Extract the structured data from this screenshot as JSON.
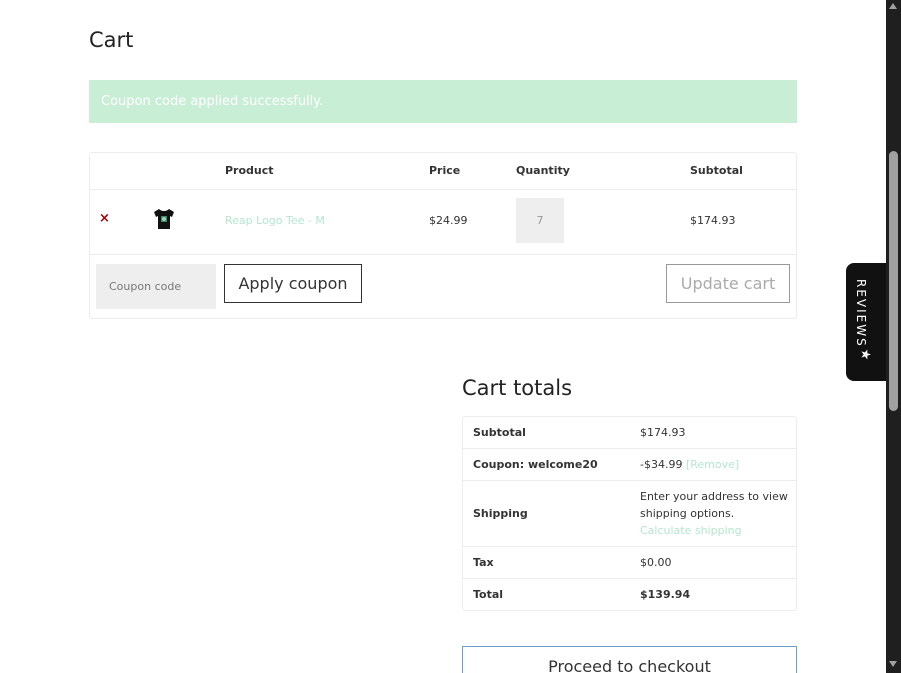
{
  "page": {
    "title": "Cart"
  },
  "notice": {
    "message": "Coupon code applied successfully."
  },
  "cart_table": {
    "headers": {
      "product": "Product",
      "price": "Price",
      "quantity": "Quantity",
      "subtotal": "Subtotal"
    },
    "items": [
      {
        "remove_glyph": "×",
        "product_name": "Reap Logo Tee - M",
        "price": "$24.99",
        "quantity": "7",
        "subtotal": "$174.93"
      }
    ],
    "coupon_placeholder": "Coupon code",
    "apply_coupon_label": "Apply coupon",
    "update_cart_label": "Update cart"
  },
  "cart_totals": {
    "title": "Cart totals",
    "subtotal_label": "Subtotal",
    "subtotal_value": "$174.93",
    "coupon_label": "Coupon: welcome20",
    "coupon_value": "-$34.99",
    "coupon_remove": "[Remove]",
    "shipping_label": "Shipping",
    "shipping_text": "Enter your address to view shipping options.",
    "calculate_shipping": "Calculate shipping",
    "tax_label": "Tax",
    "tax_value": "$0.00",
    "total_label": "Total",
    "total_value": "$139.94",
    "checkout_label": "Proceed to checkout"
  },
  "reviews_tab": {
    "label": "REVIEWS",
    "icon": "star-icon"
  },
  "colors": {
    "notice_bg": "#c8eed6",
    "link": "#b5e6d0",
    "remove": "#aa0000",
    "checkout_border": "#6aa0c8"
  }
}
